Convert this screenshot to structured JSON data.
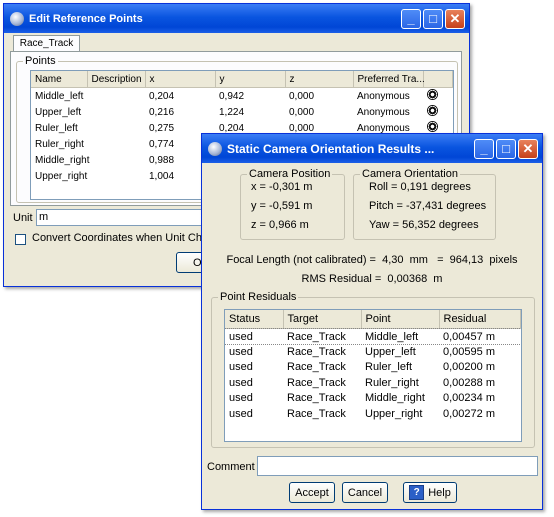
{
  "edit_window": {
    "title": "Edit Reference Points",
    "tab_label": "Race_Track",
    "group_label": "Points",
    "columns": [
      "Name",
      "Description",
      "x",
      "y",
      "z",
      "Preferred Tra..."
    ],
    "rows": [
      {
        "name": "Middle_left",
        "description": "",
        "x": "0,204",
        "y": "0,942",
        "z": "0,000",
        "tracker": "Anonymous"
      },
      {
        "name": "Upper_left",
        "description": "",
        "x": "0,216",
        "y": "1,224",
        "z": "0,000",
        "tracker": "Anonymous"
      },
      {
        "name": "Ruler_left",
        "description": "",
        "x": "0,275",
        "y": "0,204",
        "z": "0,000",
        "tracker": "Anonymous"
      },
      {
        "name": "Ruler_right",
        "description": "",
        "x": "0,774",
        "y": "",
        "z": "",
        "tracker": ""
      },
      {
        "name": "Middle_right",
        "description": "",
        "x": "0,988",
        "y": "",
        "z": "",
        "tracker": ""
      },
      {
        "name": "Upper_right",
        "description": "",
        "x": "1,004",
        "y": "",
        "z": "",
        "tracker": ""
      }
    ],
    "unit_label": "Unit",
    "unit_value": "m",
    "convert_checkbox_label": "Convert Coordinates when Unit Changes",
    "convert_checked": false,
    "ok_label": "OK",
    "row_icon": "navigation-marker-icon"
  },
  "results_window": {
    "title": "Static Camera Orientation Results ...",
    "camera_position": {
      "label": "Camera Position",
      "lines": [
        "x =   -0,301  m",
        "y =   -0,591  m",
        "z =    0,966  m"
      ]
    },
    "camera_orientation": {
      "label": "Camera Orientation",
      "lines": [
        "Roll =   0,191  degrees",
        "Pitch =  -37,431  degrees",
        "Yaw =   56,352  degrees"
      ]
    },
    "focal_length_text": "Focal Length (not calibrated) =  4,30  mm   =  964,13  pixels",
    "rms_text": "RMS Residual =  0,00368  m",
    "residuals_group_label": "Point Residuals",
    "columns": [
      "Status",
      "Target",
      "Point",
      "Residual"
    ],
    "rows": [
      {
        "status": "used",
        "target": "Race_Track",
        "point": "Middle_left",
        "residual": "0,00457 m"
      },
      {
        "status": "used",
        "target": "Race_Track",
        "point": "Upper_left",
        "residual": "0,00595 m"
      },
      {
        "status": "used",
        "target": "Race_Track",
        "point": "Ruler_left",
        "residual": "0,00200 m"
      },
      {
        "status": "used",
        "target": "Race_Track",
        "point": "Ruler_right",
        "residual": "0,00288 m"
      },
      {
        "status": "used",
        "target": "Race_Track",
        "point": "Middle_right",
        "residual": "0,00234 m"
      },
      {
        "status": "used",
        "target": "Race_Track",
        "point": "Upper_right",
        "residual": "0,00272 m"
      }
    ],
    "comment_label": "Comment",
    "comment_value": "",
    "accept_label": "Accept",
    "cancel_label": "Cancel",
    "help_label": "Help",
    "help_icon": "help-icon"
  },
  "window_buttons": {
    "minimize": "_",
    "maximize": "□",
    "close": "✕"
  },
  "colors": {
    "titlebar": "#0a55e0",
    "close_button": "#c6401a",
    "dialog_bg": "#ece9d8"
  }
}
